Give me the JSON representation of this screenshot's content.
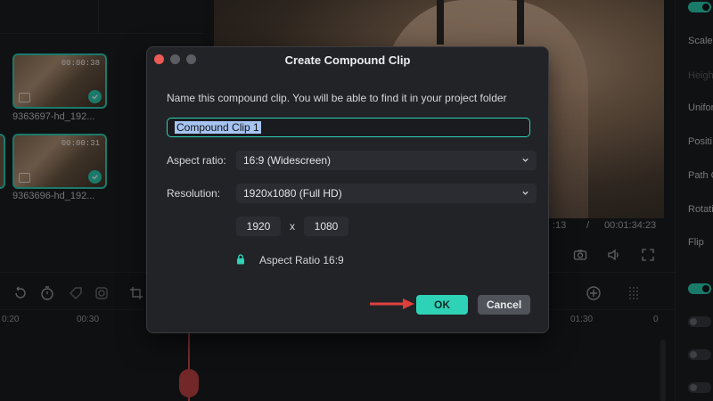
{
  "media": {
    "clips": [
      {
        "duration": "00:00:38",
        "filename": "9363697-hd_192..."
      },
      {
        "duration": "00:00:31",
        "filename": "9363696-hd_192..."
      }
    ]
  },
  "preview": {
    "current_time_partial": ":13",
    "separator": "/",
    "total_time": "00:01:34:23"
  },
  "properties": {
    "labels": [
      "Scale",
      "Heigh",
      "Unifor",
      "Positi",
      "Path C",
      "Rotati",
      "Flip"
    ],
    "dim_labels": [
      "Heigh"
    ]
  },
  "timeline": {
    "ruler_labels": [
      "0:20",
      "00:30",
      "01:30",
      "0"
    ]
  },
  "dialog": {
    "title": "Create Compound Clip",
    "description": "Name this compound clip. You will be able to find it in your project folder",
    "name_value": "Compound Clip 1",
    "aspect_label": "Aspect ratio:",
    "aspect_value": "16:9 (Widescreen)",
    "resolution_label": "Resolution:",
    "resolution_value": "1920x1080 (Full HD)",
    "width": "1920",
    "times": "x",
    "height": "1080",
    "aspect_lock_label": "Aspect Ratio 16:9",
    "ok_label": "OK",
    "cancel_label": "Cancel"
  },
  "colors": {
    "accent": "#2ed3b7",
    "close_dot": "#ec5a56",
    "dim_dot": "#5b5d63",
    "arrow": "#e0403c"
  },
  "icons": [
    "checkmark-icon",
    "film-icon",
    "camera-icon",
    "speaker-icon",
    "fullscreen-icon",
    "chevron-down-icon",
    "lock-icon",
    "undo-icon",
    "timer-icon",
    "zoom-in-icon",
    "scissors-icon",
    "arrow-icon"
  ]
}
